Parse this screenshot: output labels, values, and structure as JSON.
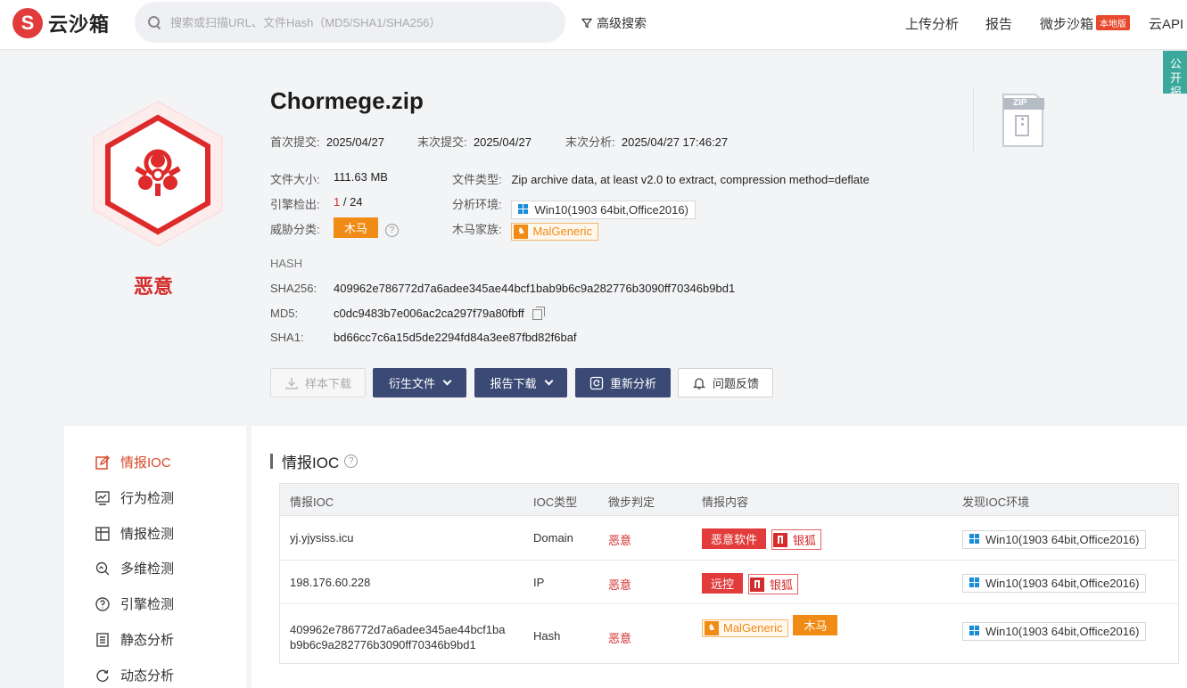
{
  "header": {
    "logo_mark": "S",
    "logo_text": "云沙箱",
    "search_placeholder": "搜索或扫描URL、文件Hash（MD5/SHA1/SHA256）",
    "advanced_search": "高级搜索",
    "nav": [
      {
        "label": "上传分析"
      },
      {
        "label": "报告"
      },
      {
        "label": "微步沙箱",
        "badge": "本地版"
      },
      {
        "label": "云API"
      }
    ]
  },
  "public_tab": "公开报告",
  "file": {
    "name": "Chormege.zip",
    "verdict": "恶意",
    "first_submit_label": "首次提交:",
    "first_submit": "2025/04/27",
    "last_submit_label": "末次提交:",
    "last_submit": "2025/04/27",
    "last_analysis_label": "末次分析:",
    "last_analysis": "2025/04/27 17:46:27",
    "size_label": "文件大小:",
    "size": "111.63 MB",
    "type_label": "文件类型:",
    "type": "Zip archive data, at least v2.0 to extract, compression method=deflate",
    "engine_label": "引擎检出:",
    "engine_hits": "1",
    "engine_total": " / 24",
    "env_label": "分析环境:",
    "env": "Win10(1903 64bit,Office2016)",
    "threat_label": "威胁分类:",
    "threat": "木马",
    "family_label": "木马家族:",
    "family": "MalGeneric",
    "zip_label": "ZIP"
  },
  "hash": {
    "heading": "HASH",
    "sha256_label": "SHA256:",
    "sha256": "409962e786772d7a6adee345ae44bcf1bab9b6c9a282776b3090ff70346b9bd1",
    "md5_label": "MD5:",
    "md5": "c0dc9483b7e006ac2ca297f79a80fbff",
    "sha1_label": "SHA1:",
    "sha1": "bd66cc7c6a15d5de2294fd84a3ee87fbd82f6baf"
  },
  "actions": {
    "download": "样本下载",
    "derived": "衍生文件",
    "report_download": "报告下载",
    "reanalyze": "重新分析",
    "feedback": "问题反馈"
  },
  "sidebar": {
    "items": [
      {
        "label": "情报IOC"
      },
      {
        "label": "行为检测"
      },
      {
        "label": "情报检测"
      },
      {
        "label": "多维检测"
      },
      {
        "label": "引擎检测"
      },
      {
        "label": "静态分析"
      },
      {
        "label": "动态分析"
      }
    ]
  },
  "ioc": {
    "title": "情报IOC",
    "columns": [
      "情报IOC",
      "IOC类型",
      "微步判定",
      "情报内容",
      "发现IOC环境"
    ],
    "rows": [
      {
        "ioc": "yj.yjysiss.icu",
        "ioc2": "",
        "type": "Domain",
        "verdict": "恶意",
        "tag1": "恶意软件",
        "tag2": "银狐",
        "env": "Win10(1903 64bit,Office2016)"
      },
      {
        "ioc": "198.176.60.228",
        "ioc2": "",
        "type": "IP",
        "verdict": "恶意",
        "tag1": "远控",
        "tag2": "银狐",
        "env": "Win10(1903 64bit,Office2016)"
      },
      {
        "ioc": "409962e786772d7a6adee345ae44bcf1ba",
        "ioc2": "b9b6c9a282776b3090ff70346b9bd1",
        "type": "Hash",
        "verdict": "恶意",
        "tag1": "MalGeneric",
        "tag2": "木马",
        "env": "Win10(1903 64bit,Office2016)"
      }
    ]
  },
  "colors": {
    "brand_red": "#e23b3b",
    "action_dark": "#3b4a75",
    "accent_orange": "#f08c16",
    "teal": "#3aa89a"
  }
}
